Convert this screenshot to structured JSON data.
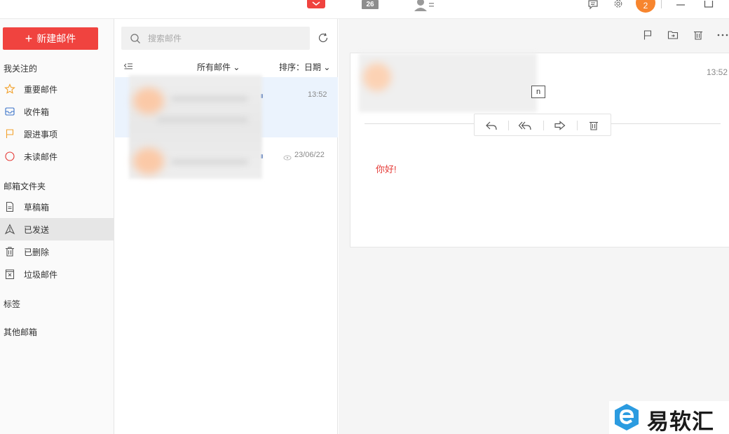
{
  "topbar": {
    "calendar_day": "26",
    "avatar_text": "2"
  },
  "sidebar": {
    "new_mail_label": "新建邮件",
    "favorites_title": "我关注的",
    "favorites": [
      {
        "label": "重要邮件",
        "icon": "star-icon"
      },
      {
        "label": "收件箱",
        "icon": "inbox-icon"
      },
      {
        "label": "跟进事项",
        "icon": "flag-icon"
      },
      {
        "label": "未读邮件",
        "icon": "circle-icon"
      }
    ],
    "folders_title": "邮箱文件夹",
    "folders": [
      {
        "label": "草稿箱",
        "icon": "draft-icon"
      },
      {
        "label": "已发送",
        "icon": "sent-icon",
        "active": true
      },
      {
        "label": "已删除",
        "icon": "trash-icon"
      },
      {
        "label": "垃圾邮件",
        "icon": "spam-icon"
      }
    ],
    "tags_label": "标签",
    "others_label": "其他邮箱"
  },
  "list": {
    "search_placeholder": "搜索邮件",
    "filter_label": "所有邮件",
    "sort_label": "排序：日期",
    "rows": [
      {
        "time": "13:52"
      },
      {
        "time": "23/06/22"
      }
    ]
  },
  "reader": {
    "time": "13:52",
    "hint_char": "n",
    "body": "你好!"
  },
  "watermark": {
    "text": "易软汇"
  },
  "colors": {
    "accent": "#f0433f",
    "avatar": "#f7852e",
    "selected_row": "#ebf3fd",
    "body_text": "#e53935"
  }
}
